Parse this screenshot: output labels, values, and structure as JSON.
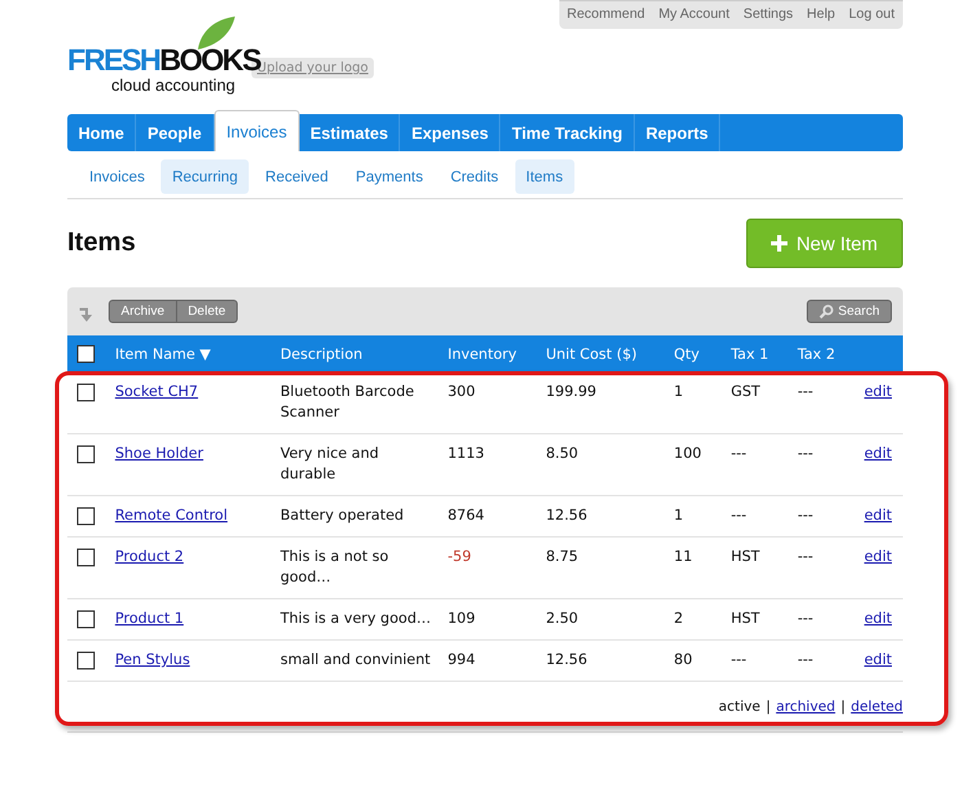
{
  "top_links": [
    "Recommend",
    "My Account",
    "Settings",
    "Help",
    "Log out"
  ],
  "logo": {
    "part1": "FRESH",
    "part2": "BOOKS",
    "tagline": "cloud accounting"
  },
  "upload_logo": "Upload your logo",
  "nav": [
    {
      "label": "Home",
      "selected": false
    },
    {
      "label": "People",
      "selected": false
    },
    {
      "label": "Invoices",
      "selected": true
    },
    {
      "label": "Estimates",
      "selected": false
    },
    {
      "label": "Expenses",
      "selected": false
    },
    {
      "label": "Time Tracking",
      "selected": false
    },
    {
      "label": "Reports",
      "selected": false
    }
  ],
  "subnav": [
    {
      "label": "Invoices",
      "selected": false
    },
    {
      "label": "Recurring",
      "selected": true
    },
    {
      "label": "Received",
      "selected": false
    },
    {
      "label": "Payments",
      "selected": false
    },
    {
      "label": "Credits",
      "selected": false
    },
    {
      "label": "Items",
      "selected": true
    }
  ],
  "title": "Items",
  "new_button": "New Item",
  "toolbar": {
    "buttons": [
      "Archive",
      "Delete"
    ],
    "search": "Search"
  },
  "table": {
    "select_all_checked": false,
    "columns": [
      "Item Name ▼",
      "Description",
      "Inventory",
      "Unit Cost ($)",
      "Qty",
      "Tax 1",
      "Tax 2"
    ],
    "rows": [
      {
        "name": "Socket CH7",
        "description": "Bluetooth Barcode Scanner",
        "inventory": "300",
        "negative": false,
        "unit_cost": "199.99",
        "qty": "1",
        "tax1": "GST",
        "tax2": "---",
        "action": "edit",
        "checked": false
      },
      {
        "name": "Shoe Holder",
        "description": "Very nice and durable",
        "inventory": "1113",
        "negative": false,
        "unit_cost": "8.50",
        "qty": "100",
        "tax1": "---",
        "tax2": "---",
        "action": "edit",
        "checked": false
      },
      {
        "name": "Remote Control",
        "description": "Battery operated",
        "inventory": "8764",
        "negative": false,
        "unit_cost": "12.56",
        "qty": "1",
        "tax1": "---",
        "tax2": "---",
        "action": "edit",
        "checked": false
      },
      {
        "name": "Product 2",
        "description": "This is a not so good…",
        "inventory": "-59",
        "negative": true,
        "unit_cost": "8.75",
        "qty": "11",
        "tax1": "HST",
        "tax2": "---",
        "action": "edit",
        "checked": false
      },
      {
        "name": "Product 1",
        "description": "This is a very good…",
        "inventory": "109",
        "negative": false,
        "unit_cost": "2.50",
        "qty": "2",
        "tax1": "HST",
        "tax2": "---",
        "action": "edit",
        "checked": false
      },
      {
        "name": "Pen Stylus",
        "description": "small and convinient",
        "inventory": "994",
        "negative": false,
        "unit_cost": "12.56",
        "qty": "80",
        "tax1": "---",
        "tax2": "---",
        "action": "edit",
        "checked": false
      }
    ]
  },
  "filter_separator": "|",
  "filters": [
    {
      "label": "active",
      "selected": true
    },
    {
      "label": "archived",
      "selected": false
    },
    {
      "label": "deleted",
      "selected": false
    }
  ]
}
